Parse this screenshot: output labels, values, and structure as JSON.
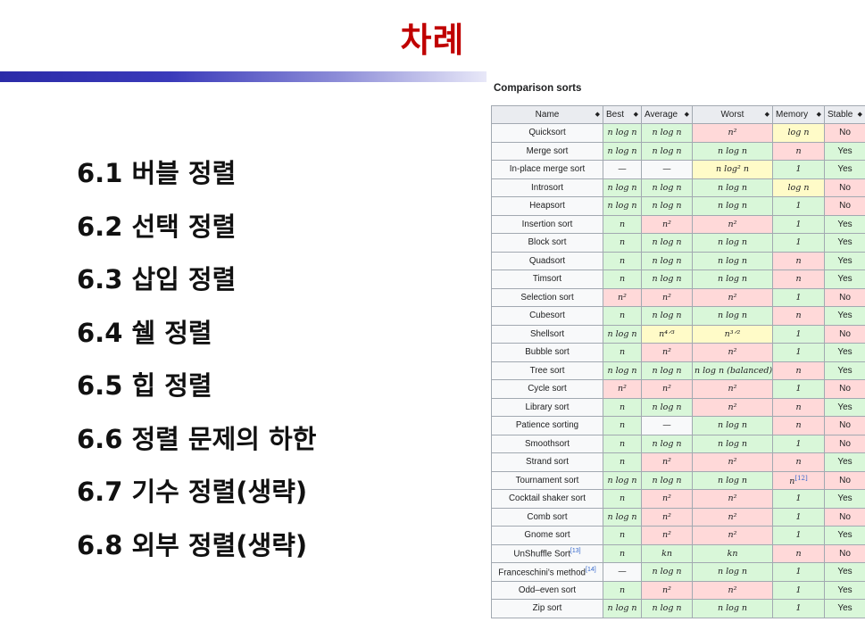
{
  "slide": {
    "title": "차례"
  },
  "toc": [
    "6.1 버블 정렬",
    "6.2 선택 정렬",
    "6.3 삽입 정렬",
    "6.4 쉘 정렬",
    "6.5 힙 정렬",
    "6.6 정렬 문제의 하한",
    "6.7 기수 정렬(생략)",
    "6.8 외부 정렬(생략)"
  ],
  "table": {
    "caption": "Comparison sorts",
    "headers": [
      "Name",
      "Best",
      "Average",
      "Worst",
      "Memory",
      "Stable"
    ],
    "sort_arrow": "◆",
    "rows": [
      {
        "name": "Quicksort",
        "best": "n log n",
        "avg": "n log n",
        "worst": "n²",
        "mem": "log n",
        "stable": "No",
        "c": [
          "good",
          "good",
          "bad",
          "mid",
          "bad"
        ]
      },
      {
        "name": "Merge sort",
        "best": "n log n",
        "avg": "n log n",
        "worst": "n log n",
        "mem": "n",
        "stable": "Yes",
        "c": [
          "good",
          "good",
          "good",
          "bad",
          "good"
        ]
      },
      {
        "name": "In-place merge sort",
        "best": "—",
        "avg": "—",
        "worst": "n log² n",
        "mem": "1",
        "stable": "Yes",
        "c": [
          "plain",
          "plain",
          "mid",
          "good",
          "good"
        ]
      },
      {
        "name": "Introsort",
        "best": "n log n",
        "avg": "n log n",
        "worst": "n log n",
        "mem": "log n",
        "stable": "No",
        "c": [
          "good",
          "good",
          "good",
          "mid",
          "bad"
        ]
      },
      {
        "name": "Heapsort",
        "best": "n log n",
        "avg": "n log n",
        "worst": "n log n",
        "mem": "1",
        "stable": "No",
        "c": [
          "good",
          "good",
          "good",
          "good",
          "bad"
        ]
      },
      {
        "name": "Insertion sort",
        "best": "n",
        "avg": "n²",
        "worst": "n²",
        "mem": "1",
        "stable": "Yes",
        "c": [
          "good",
          "bad",
          "bad",
          "good",
          "good"
        ]
      },
      {
        "name": "Block sort",
        "best": "n",
        "avg": "n log n",
        "worst": "n log n",
        "mem": "1",
        "stable": "Yes",
        "c": [
          "good",
          "good",
          "good",
          "good",
          "good"
        ]
      },
      {
        "name": "Quadsort",
        "best": "n",
        "avg": "n log n",
        "worst": "n log n",
        "mem": "n",
        "stable": "Yes",
        "c": [
          "good",
          "good",
          "good",
          "bad",
          "good"
        ]
      },
      {
        "name": "Timsort",
        "best": "n",
        "avg": "n log n",
        "worst": "n log n",
        "mem": "n",
        "stable": "Yes",
        "c": [
          "good",
          "good",
          "good",
          "bad",
          "good"
        ]
      },
      {
        "name": "Selection sort",
        "best": "n²",
        "avg": "n²",
        "worst": "n²",
        "mem": "1",
        "stable": "No",
        "c": [
          "bad",
          "bad",
          "bad",
          "good",
          "bad"
        ]
      },
      {
        "name": "Cubesort",
        "best": "n",
        "avg": "n log n",
        "worst": "n log n",
        "mem": "n",
        "stable": "Yes",
        "c": [
          "good",
          "good",
          "good",
          "bad",
          "good"
        ]
      },
      {
        "name": "Shellsort",
        "best": "n log n",
        "avg": "n⁴ᐟ³",
        "worst": "n³ᐟ²",
        "mem": "1",
        "stable": "No",
        "c": [
          "good",
          "mid",
          "mid",
          "good",
          "bad"
        ]
      },
      {
        "name": "Bubble sort",
        "best": "n",
        "avg": "n²",
        "worst": "n²",
        "mem": "1",
        "stable": "Yes",
        "c": [
          "good",
          "bad",
          "bad",
          "good",
          "good"
        ]
      },
      {
        "name": "Tree sort",
        "best": "n log n",
        "avg": "n log n",
        "worst": "n log n (balanced)",
        "mem": "n",
        "stable": "Yes",
        "c": [
          "good",
          "good",
          "good",
          "bad",
          "good"
        ]
      },
      {
        "name": "Cycle sort",
        "best": "n²",
        "avg": "n²",
        "worst": "n²",
        "mem": "1",
        "stable": "No",
        "c": [
          "bad",
          "bad",
          "bad",
          "good",
          "bad"
        ]
      },
      {
        "name": "Library sort",
        "best": "n",
        "avg": "n log n",
        "worst": "n²",
        "mem": "n",
        "stable": "Yes",
        "c": [
          "good",
          "good",
          "bad",
          "bad",
          "good"
        ]
      },
      {
        "name": "Patience sorting",
        "best": "n",
        "avg": "—",
        "worst": "n log n",
        "mem": "n",
        "stable": "No",
        "c": [
          "good",
          "plain",
          "good",
          "bad",
          "bad"
        ]
      },
      {
        "name": "Smoothsort",
        "best": "n",
        "avg": "n log n",
        "worst": "n log n",
        "mem": "1",
        "stable": "No",
        "c": [
          "good",
          "good",
          "good",
          "good",
          "bad"
        ]
      },
      {
        "name": "Strand sort",
        "best": "n",
        "avg": "n²",
        "worst": "n²",
        "mem": "n",
        "stable": "Yes",
        "c": [
          "good",
          "bad",
          "bad",
          "bad",
          "good"
        ]
      },
      {
        "name": "Tournament sort",
        "best": "n log n",
        "avg": "n log n",
        "worst": "n log n",
        "mem": "n",
        "memref": "[12]",
        "stable": "No",
        "c": [
          "good",
          "good",
          "good",
          "bad",
          "bad"
        ]
      },
      {
        "name": "Cocktail shaker sort",
        "best": "n",
        "avg": "n²",
        "worst": "n²",
        "mem": "1",
        "stable": "Yes",
        "c": [
          "good",
          "bad",
          "bad",
          "good",
          "good"
        ]
      },
      {
        "name": "Comb sort",
        "best": "n log n",
        "avg": "n²",
        "worst": "n²",
        "mem": "1",
        "stable": "No",
        "c": [
          "good",
          "bad",
          "bad",
          "good",
          "bad"
        ]
      },
      {
        "name": "Gnome sort",
        "best": "n",
        "avg": "n²",
        "worst": "n²",
        "mem": "1",
        "stable": "Yes",
        "c": [
          "good",
          "bad",
          "bad",
          "good",
          "good"
        ]
      },
      {
        "name": "UnShuffle Sort",
        "nameref": "[13]",
        "dark": true,
        "best": "n",
        "avg": "kn",
        "worst": "kn",
        "mem": "n",
        "stable": "No",
        "c": [
          "good",
          "good",
          "good",
          "bad",
          "bad"
        ]
      },
      {
        "name": "Franceschini's method",
        "nameref": "[14]",
        "dark": true,
        "best": "—",
        "avg": "n log n",
        "worst": "n log n",
        "mem": "1",
        "stable": "Yes",
        "c": [
          "plain",
          "good",
          "good",
          "good",
          "good"
        ]
      },
      {
        "name": "Odd–even sort",
        "best": "n",
        "avg": "n²",
        "worst": "n²",
        "mem": "1",
        "stable": "Yes",
        "c": [
          "good",
          "bad",
          "bad",
          "good",
          "good"
        ]
      },
      {
        "name": "Zip sort",
        "dark": true,
        "best": "n log n",
        "avg": "n log n",
        "worst": "n log n",
        "mem": "1",
        "stable": "Yes",
        "c": [
          "good",
          "good",
          "good",
          "good",
          "good"
        ]
      }
    ]
  }
}
